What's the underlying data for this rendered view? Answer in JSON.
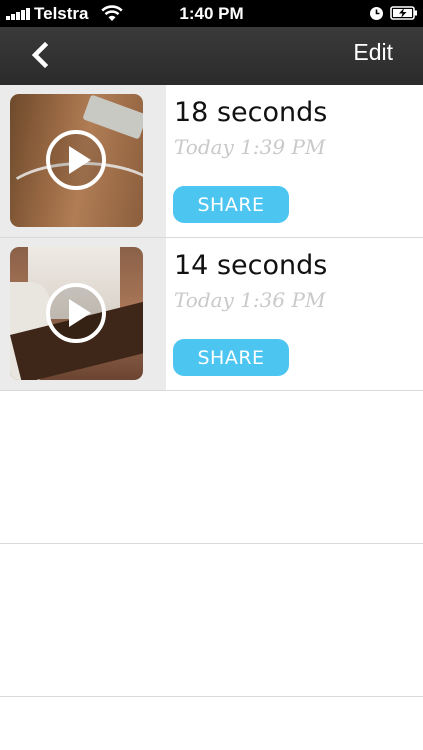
{
  "status_bar": {
    "carrier": "Telstra",
    "time": "1:40 PM",
    "icons": [
      "signal-icon",
      "wifi-icon",
      "alarm-icon",
      "battery-charging-icon"
    ]
  },
  "nav": {
    "back_icon": "chevron-left-icon",
    "edit_label": "Edit"
  },
  "videos": [
    {
      "duration": "18 seconds",
      "date": "Today 1:39 PM",
      "share_label": "SHARE"
    },
    {
      "duration": "14 seconds",
      "date": "Today 1:36 PM",
      "share_label": "SHARE"
    }
  ],
  "colors": {
    "nav_background": "#333333",
    "share_button": "#4cc5f1",
    "date_text": "#c9c9c9"
  }
}
